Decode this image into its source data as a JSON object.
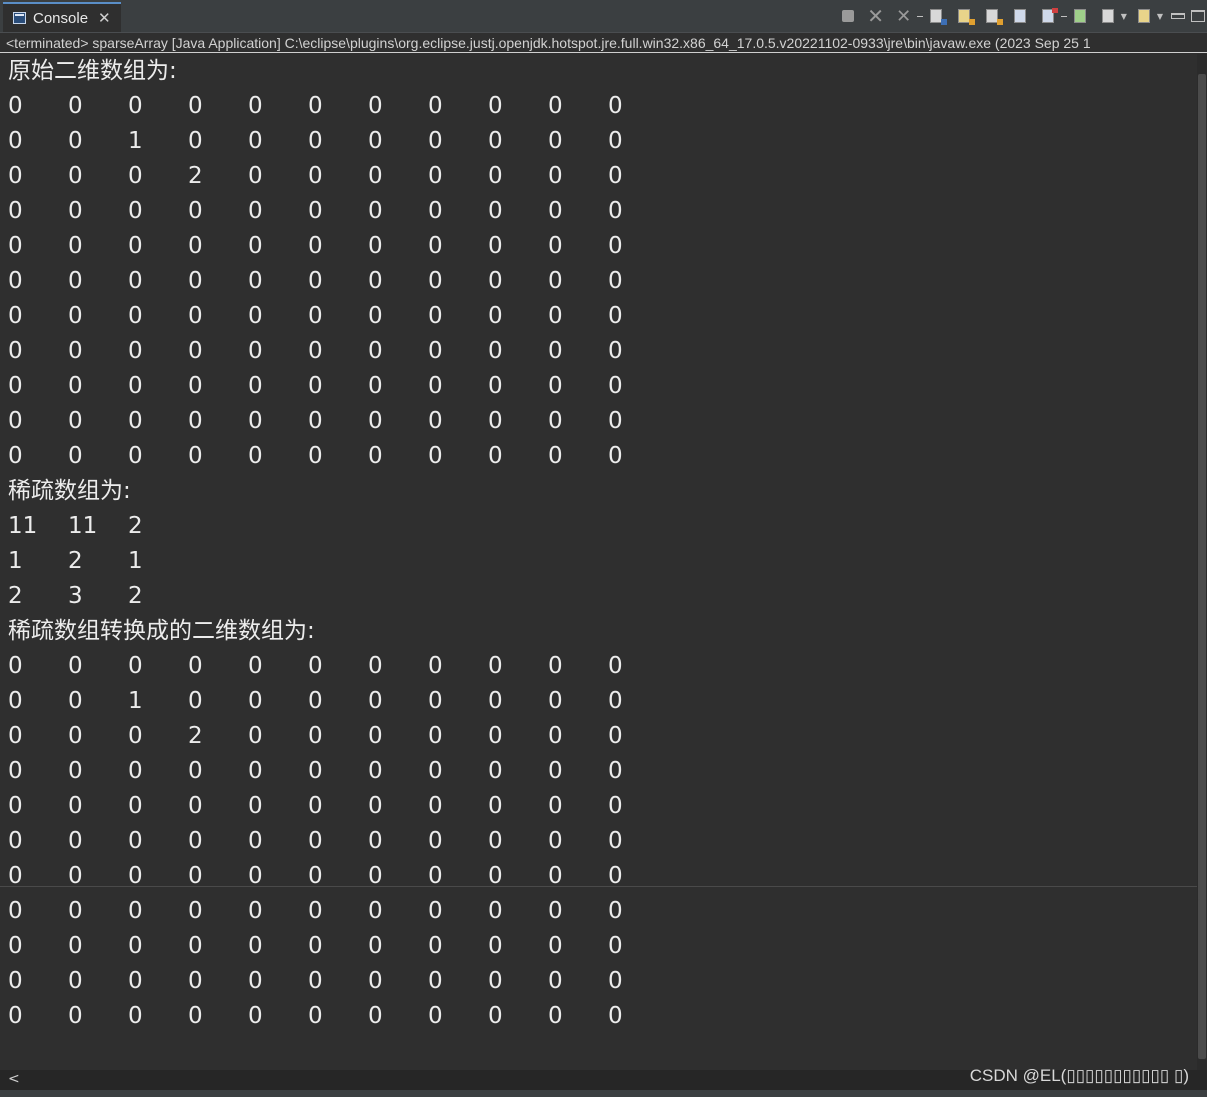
{
  "tab": {
    "label": "Console",
    "icon": "console-icon",
    "close_glyph": "✕"
  },
  "toolbar": {
    "buttons": [
      "terminate-icon",
      "remove-launch-icon",
      "remove-all-launches-icon",
      "scroll-lock-icon",
      "word-wrap-icon",
      "show-stdout-icon",
      "show-stderr-icon",
      "pin-console-icon",
      "display-console-icon",
      "open-console-icon",
      "minimize-icon",
      "maximize-icon"
    ]
  },
  "launch_info": "<terminated> sparseArray [Java Application] C:\\eclipse\\plugins\\org.eclipse.justj.openjdk.hotspot.jre.full.win32.x86_64_17.0.5.v20221102-0933\\jre\\bin\\javaw.exe  (2023 Sep 25 1",
  "output": {
    "heading_original": "原始二维数组为:",
    "original_rows": [
      [
        "0",
        "0",
        "0",
        "0",
        "0",
        "0",
        "0",
        "0",
        "0",
        "0",
        "0"
      ],
      [
        "0",
        "0",
        "1",
        "0",
        "0",
        "0",
        "0",
        "0",
        "0",
        "0",
        "0"
      ],
      [
        "0",
        "0",
        "0",
        "2",
        "0",
        "0",
        "0",
        "0",
        "0",
        "0",
        "0"
      ],
      [
        "0",
        "0",
        "0",
        "0",
        "0",
        "0",
        "0",
        "0",
        "0",
        "0",
        "0"
      ],
      [
        "0",
        "0",
        "0",
        "0",
        "0",
        "0",
        "0",
        "0",
        "0",
        "0",
        "0"
      ],
      [
        "0",
        "0",
        "0",
        "0",
        "0",
        "0",
        "0",
        "0",
        "0",
        "0",
        "0"
      ],
      [
        "0",
        "0",
        "0",
        "0",
        "0",
        "0",
        "0",
        "0",
        "0",
        "0",
        "0"
      ],
      [
        "0",
        "0",
        "0",
        "0",
        "0",
        "0",
        "0",
        "0",
        "0",
        "0",
        "0"
      ],
      [
        "0",
        "0",
        "0",
        "0",
        "0",
        "0",
        "0",
        "0",
        "0",
        "0",
        "0"
      ],
      [
        "0",
        "0",
        "0",
        "0",
        "0",
        "0",
        "0",
        "0",
        "0",
        "0",
        "0"
      ],
      [
        "0",
        "0",
        "0",
        "0",
        "0",
        "0",
        "0",
        "0",
        "0",
        "0",
        "0"
      ]
    ],
    "heading_sparse": "稀疏数组为:",
    "sparse_rows": [
      [
        "11",
        "11",
        "2"
      ],
      [
        "1",
        "2",
        "1"
      ],
      [
        "2",
        "3",
        "2"
      ]
    ],
    "heading_restored": "稀疏数组转换成的二维数组为:",
    "restored_rows": [
      [
        "0",
        "0",
        "0",
        "0",
        "0",
        "0",
        "0",
        "0",
        "0",
        "0",
        "0"
      ],
      [
        "0",
        "0",
        "1",
        "0",
        "0",
        "0",
        "0",
        "0",
        "0",
        "0",
        "0"
      ],
      [
        "0",
        "0",
        "0",
        "2",
        "0",
        "0",
        "0",
        "0",
        "0",
        "0",
        "0"
      ],
      [
        "0",
        "0",
        "0",
        "0",
        "0",
        "0",
        "0",
        "0",
        "0",
        "0",
        "0"
      ],
      [
        "0",
        "0",
        "0",
        "0",
        "0",
        "0",
        "0",
        "0",
        "0",
        "0",
        "0"
      ],
      [
        "0",
        "0",
        "0",
        "0",
        "0",
        "0",
        "0",
        "0",
        "0",
        "0",
        "0"
      ],
      [
        "0",
        "0",
        "0",
        "0",
        "0",
        "0",
        "0",
        "0",
        "0",
        "0",
        "0"
      ],
      [
        "0",
        "0",
        "0",
        "0",
        "0",
        "0",
        "0",
        "0",
        "0",
        "0",
        "0"
      ],
      [
        "0",
        "0",
        "0",
        "0",
        "0",
        "0",
        "0",
        "0",
        "0",
        "0",
        "0"
      ],
      [
        "0",
        "0",
        "0",
        "0",
        "0",
        "0",
        "0",
        "0",
        "0",
        "0",
        "0"
      ],
      [
        "0",
        "0",
        "0",
        "0",
        "0",
        "0",
        "0",
        "0",
        "0",
        "0",
        "0"
      ]
    ]
  },
  "scrollbar": {
    "left_arrow": "<"
  },
  "watermark": "CSDN @EL(",
  "watermark_tail": "▯▯▯▯▯▯▯▯▯▯▯ ▯)"
}
